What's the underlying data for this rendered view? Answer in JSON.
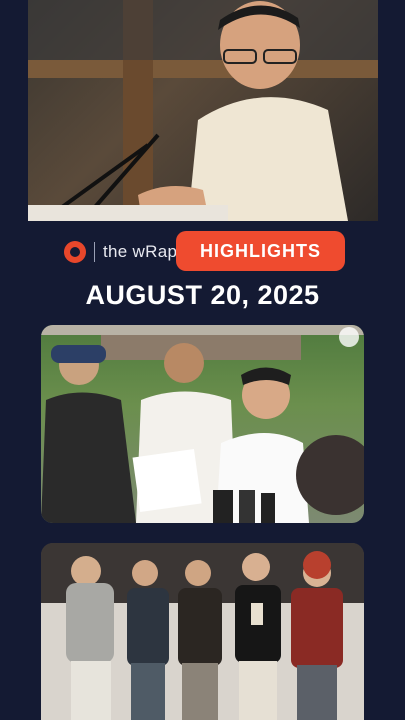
{
  "header": {
    "brand_text": "the wRap",
    "pill_label": "HIGHLIGHTS",
    "date": "AUGUST 20, 2025"
  },
  "colors": {
    "background": "#141a33",
    "accent": "#ef4b2f"
  },
  "icons": {
    "brand_logo": "rappler-logo-icon"
  },
  "media": [
    "news-photo-senate-hearing",
    "news-photo-flood-control-inspection",
    "news-photo-band-poster"
  ]
}
